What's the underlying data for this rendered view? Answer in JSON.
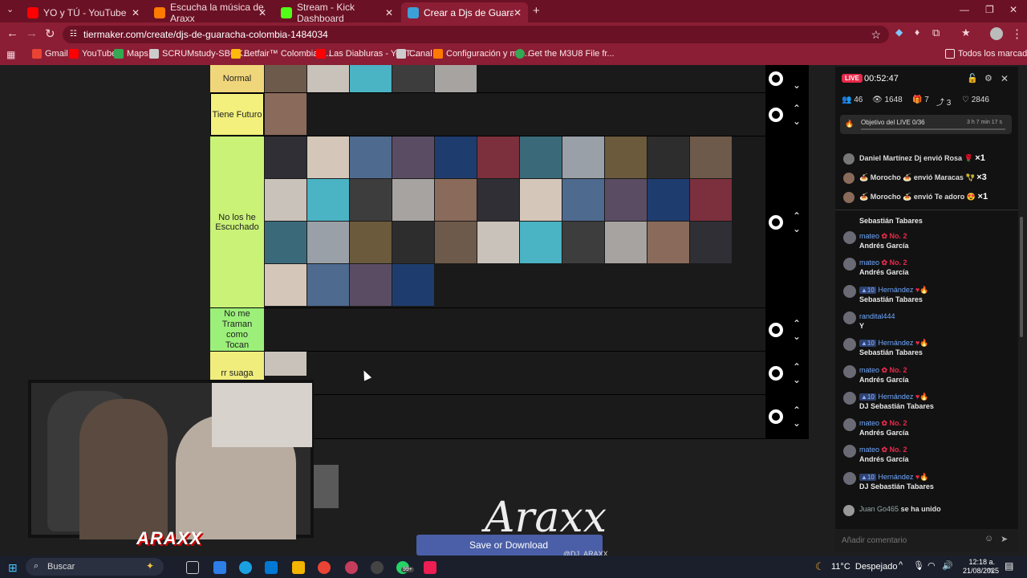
{
  "browser": {
    "tabs": [
      {
        "title": "YO y TÚ - YouTube",
        "color": "#ff0000"
      },
      {
        "title": "Escucha la música de Araxx",
        "color": "#ff7a00"
      },
      {
        "title": "Stream - Kick Dashboard",
        "color": "#53fc18"
      },
      {
        "title": "Crear a Djs de Guaracha COLO",
        "color": "#3da0d8"
      }
    ],
    "url": "tiermaker.com/create/djs-de-guaracha-colombia-1484034",
    "bookmarks": [
      {
        "label": "Gmail",
        "color": "#ea4335"
      },
      {
        "label": "YouTube",
        "color": "#ff0000"
      },
      {
        "label": "Maps",
        "color": "#34a853"
      },
      {
        "label": "SCRUMstudy-SBOK...",
        "color": "#cccccc"
      },
      {
        "label": "Betfair™ Colombia -...",
        "color": "#ffb80c"
      },
      {
        "label": "Las Diabluras - YouT...",
        "color": "#ff0000"
      },
      {
        "label": "Canal",
        "color": "#cccccc"
      },
      {
        "label": "Configuración y má...",
        "color": "#ff7a00"
      },
      {
        "label": "Get the M3U8 File fr...",
        "color": "#34a853"
      }
    ],
    "bookmarks_folder": "Todos los marcadores"
  },
  "tierlist": {
    "tiers": [
      {
        "label": "Normal",
        "color": "#f0d67a"
      },
      {
        "label": "Tiene Futuro",
        "color": "#f3f07d"
      },
      {
        "label": "No los he Escuchado",
        "color": "#c9f277"
      },
      {
        "label": "No me Traman como Tocan",
        "color": "#9cf07a"
      },
      {
        "label": "rr suaga",
        "color": "#f0ed7d"
      },
      {
        "label": "",
        "color": "#1a1a1a"
      }
    ],
    "save_button": "Save or Download",
    "overlay_handle": "@DJ_ARAXX"
  },
  "chat": {
    "live_label": "LIVE",
    "timer": "00:52:47",
    "stats": {
      "viewers": "46",
      "views": "1648",
      "gifts": "7",
      "shares": "3",
      "likes": "2846"
    },
    "goal": {
      "label": "Objetivo del LIVE",
      "value": "0/36",
      "time": "3 h 7 min 17 s"
    },
    "gifts": [
      {
        "text": "Daniel Martínez Dj envió Rosa",
        "count": "×1"
      },
      {
        "text": "🍝 Morocho 🍝 envió Maracas",
        "count": "×3"
      },
      {
        "text": "🍝 Morocho 🍝 envió Te adoro",
        "count": "×1"
      }
    ],
    "top_text": "Sebastián Tabares",
    "messages": [
      {
        "user": "mateo",
        "badge": "No. 2",
        "text": "Andrés García"
      },
      {
        "user": "mateo",
        "badge": "No. 2",
        "text": "Andrés García"
      },
      {
        "user": "Hernández",
        "level": "10",
        "text": "Sebastián Tabares"
      },
      {
        "user": "randital444",
        "text": "Y"
      },
      {
        "user": "Hernández",
        "level": "10",
        "text": "Sebastián Tabares"
      },
      {
        "user": "mateo",
        "badge": "No. 2",
        "text": "Andrés García"
      },
      {
        "user": "Hernández",
        "level": "10",
        "text": "DJ Sebastián Tabares"
      },
      {
        "user": "mateo",
        "badge": "No. 2",
        "text": "Andrés García"
      },
      {
        "user": "mateo",
        "badge": "No. 2",
        "text": "Andrés García"
      },
      {
        "user": "Hernández",
        "level": "10",
        "text": "DJ Sebastián Tabares"
      }
    ],
    "join_user": "Juan Go465",
    "join_text": "se ha unido",
    "comment_placeholder": "Añadir comentario"
  },
  "overlay": {
    "webcam_logo": "ARAXX",
    "signature": "Araxx"
  },
  "taskbar": {
    "search": "Buscar",
    "weather": "11°C  Despejado",
    "time": "12:18 a. m.",
    "date": "21/08/2025",
    "badge": "99+"
  }
}
